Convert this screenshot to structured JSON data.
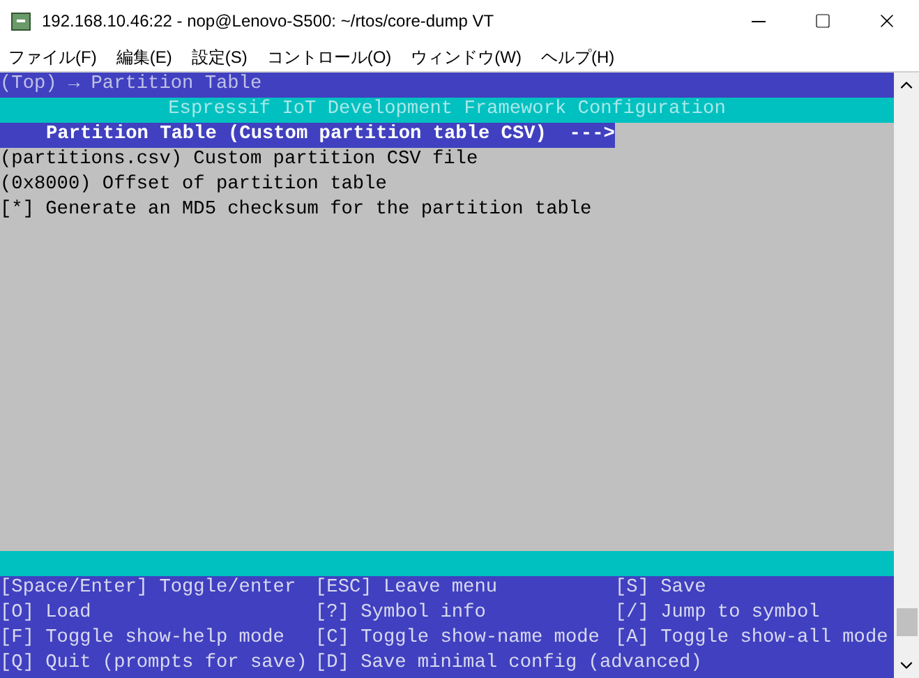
{
  "window": {
    "title": "192.168.10.46:22 - nop@Lenovo-S500: ~/rtos/core-dump VT"
  },
  "menu": [
    "ファイル(F)",
    "編集(E)",
    "設定(S)",
    "コントロール(O)",
    "ウィンドウ(W)",
    "ヘルプ(H)"
  ],
  "terminal": {
    "breadcrumb": "(Top) → Partition Table",
    "header": "Espressif IoT Development Framework Configuration",
    "items": [
      {
        "kind": "submenu",
        "text": "Partition Table (Custom partition table CSV)  --->",
        "selected": true
      },
      {
        "kind": "option",
        "text": "(partitions.csv) Custom partition CSV file",
        "selected": false
      },
      {
        "kind": "option",
        "text": "(0x8000) Offset of partition table",
        "selected": false
      },
      {
        "kind": "option",
        "text": "[*] Generate an MD5 checksum for the partition table",
        "selected": false
      }
    ],
    "footer": [
      [
        "[Space/Enter] Toggle/enter",
        "[ESC] Leave menu",
        "[S] Save"
      ],
      [
        "[O] Load",
        "[?] Symbol info",
        "[/] Jump to symbol"
      ],
      [
        "[F] Toggle show-help mode",
        "[C] Toggle show-name mode",
        "[A] Toggle show-all mode"
      ],
      [
        "[Q] Quit (prompts for save)",
        "[D] Save minimal config (advanced)"
      ]
    ]
  }
}
